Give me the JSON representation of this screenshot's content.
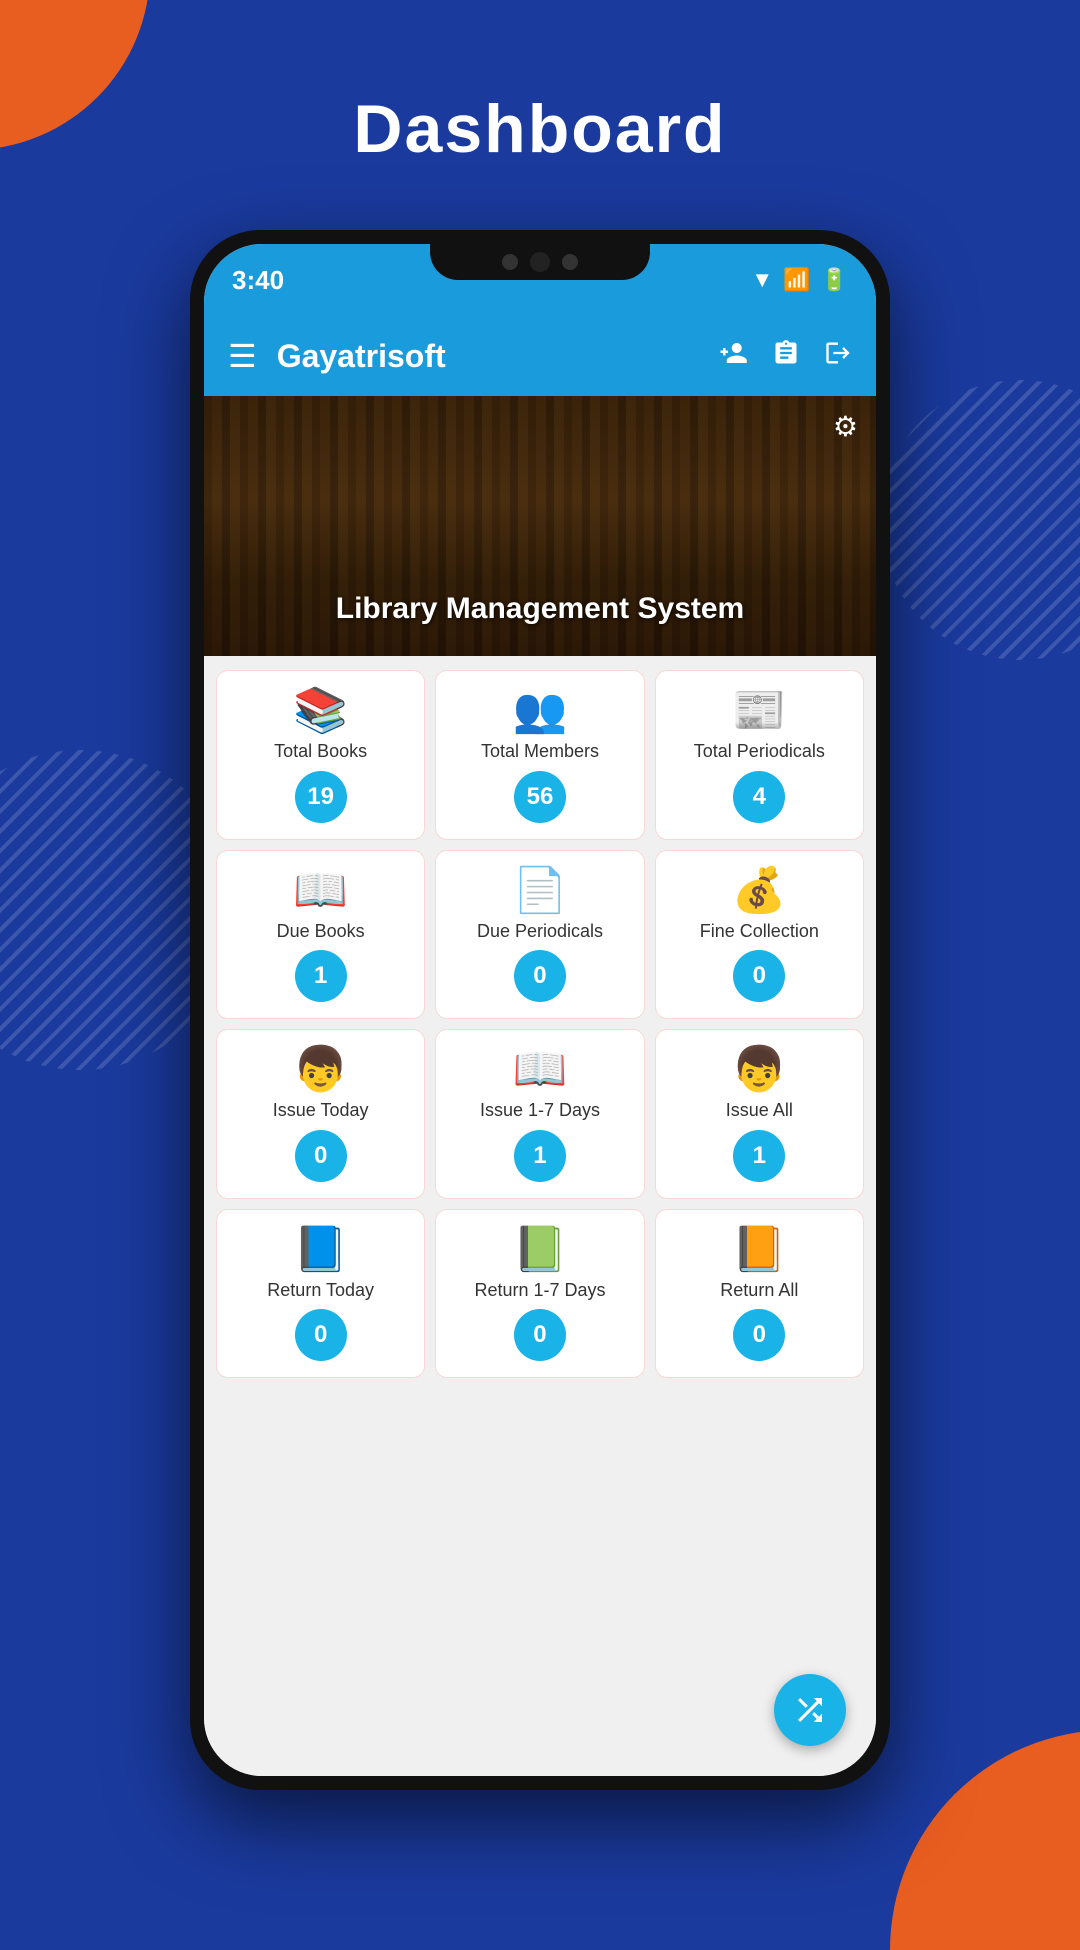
{
  "page": {
    "title": "Dashboard",
    "background_color": "#1a3a9e"
  },
  "phone": {
    "status_time": "3:40",
    "app_bar": {
      "title": "Gayatrisoft",
      "menu_label": "☰",
      "add_user_icon": "👤+",
      "notes_icon": "📋",
      "logout_icon": "⮕"
    },
    "hero": {
      "title": "Library Management System",
      "gear_icon": "⚙"
    },
    "stats": {
      "row1": [
        {
          "label": "Total Books",
          "value": "19",
          "icon": "📚"
        },
        {
          "label": "Total Members",
          "value": "56",
          "icon": "👥"
        },
        {
          "label": "Total Periodicals",
          "value": "4",
          "icon": "📰"
        }
      ],
      "row2": [
        {
          "label": "Due Books",
          "value": "1",
          "icon": "📖"
        },
        {
          "label": "Due Periodicals",
          "value": "0",
          "icon": "📄"
        },
        {
          "label": "Fine Collection",
          "value": "0",
          "icon": "💰"
        }
      ],
      "row3": [
        {
          "label": "Issue Today",
          "value": "0",
          "icon": "👦"
        },
        {
          "label": "Issue 1-7 Days",
          "value": "1",
          "icon": "📖"
        },
        {
          "label": "Issue All",
          "value": "1",
          "icon": "👦"
        }
      ],
      "row4": [
        {
          "label": "Return Today",
          "value": "0",
          "icon": "📘"
        },
        {
          "label": "Return 1-7 Days",
          "value": "0",
          "icon": "📗"
        },
        {
          "label": "Return All",
          "value": "0",
          "icon": "📙"
        }
      ]
    },
    "fab_icon": "⇄"
  }
}
